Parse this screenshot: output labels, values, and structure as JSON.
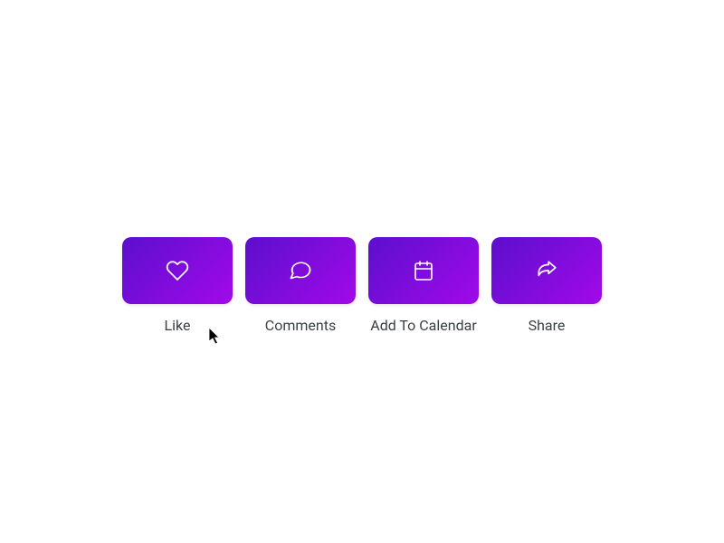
{
  "actions": [
    {
      "name": "like",
      "label": "Like",
      "icon": "heart-icon"
    },
    {
      "name": "comments",
      "label": "Comments",
      "icon": "comment-icon"
    },
    {
      "name": "add-to-calendar",
      "label": "Add To Calendar",
      "icon": "calendar-icon"
    },
    {
      "name": "share",
      "label": "Share",
      "icon": "share-icon"
    }
  ],
  "colors": {
    "gradient_start": "#5b0fce",
    "gradient_end": "#a209e8",
    "label": "#3a3f44",
    "icon_stroke": "#ffffff",
    "background": "#ffffff"
  }
}
